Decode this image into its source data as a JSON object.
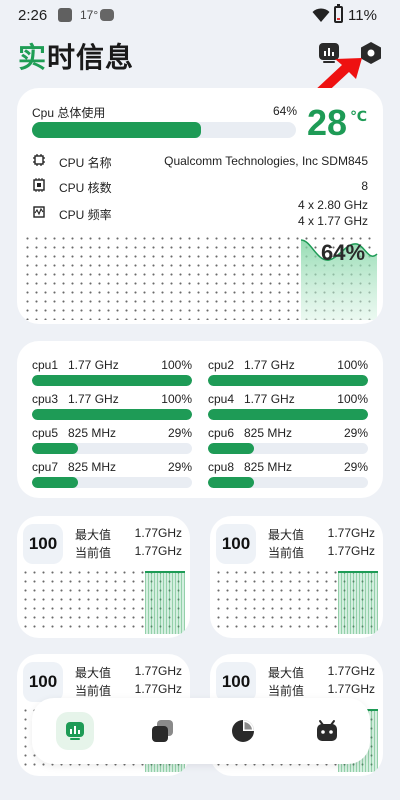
{
  "status_bar": {
    "time": "2:26",
    "temp": "17°",
    "battery": "11%"
  },
  "header": {
    "title_accent": "实",
    "title_rest": "时信息",
    "icons": [
      "chart-icon",
      "settings-hexagon-icon"
    ]
  },
  "cpu_card": {
    "usage_label": "Cpu 总体使用",
    "usage_pct": "64%",
    "usage_fraction": 0.64,
    "temp_value": "28",
    "temp_unit": "℃",
    "rows": [
      {
        "label": "CPU 名称",
        "value": "Qualcomm Technologies, Inc SDM845"
      },
      {
        "label": "CPU 核数",
        "value": "8"
      },
      {
        "label": "CPU 频率",
        "value_line1": "4 x 2.80 GHz",
        "value_line2": "4 x 1.77 GHz"
      }
    ],
    "graph_pct": "64%"
  },
  "cores": [
    {
      "name": "cpu1",
      "freq": "1.77 GHz",
      "pct": "100%",
      "fraction": 1.0
    },
    {
      "name": "cpu2",
      "freq": "1.77 GHz",
      "pct": "100%",
      "fraction": 1.0
    },
    {
      "name": "cpu3",
      "freq": "1.77 GHz",
      "pct": "100%",
      "fraction": 1.0
    },
    {
      "name": "cpu4",
      "freq": "1.77 GHz",
      "pct": "100%",
      "fraction": 1.0
    },
    {
      "name": "cpu5",
      "freq": "825 MHz",
      "pct": "29%",
      "fraction": 0.29
    },
    {
      "name": "cpu6",
      "freq": "825 MHz",
      "pct": "29%",
      "fraction": 0.29
    },
    {
      "name": "cpu7",
      "freq": "825 MHz",
      "pct": "29%",
      "fraction": 0.29
    },
    {
      "name": "cpu8",
      "freq": "825 MHz",
      "pct": "29%",
      "fraction": 0.29
    }
  ],
  "mini_cards": [
    {
      "badge": "100",
      "max_label": "最大值",
      "max_value": "1.77GHz",
      "cur_label": "当前值",
      "cur_value": "1.77GHz"
    },
    {
      "badge": "100",
      "max_label": "最大值",
      "max_value": "1.77GHz",
      "cur_label": "当前值",
      "cur_value": "1.77GHz"
    },
    {
      "badge": "100",
      "max_label": "最大值",
      "max_value": "1.77GHz",
      "cur_label": "当前值",
      "cur_value": "1.77GHz"
    },
    {
      "badge": "100",
      "max_label": "最大值",
      "max_value": "1.77GHz",
      "cur_label": "当前值",
      "cur_value": "1.77GHz"
    }
  ],
  "nav": {
    "items": [
      "realtime-info-icon",
      "layers-icon",
      "pie-chart-icon",
      "android-icon"
    ],
    "active_index": 0
  },
  "colors": {
    "accent": "#1e9b56",
    "annotation_arrow": "#ee1111"
  }
}
